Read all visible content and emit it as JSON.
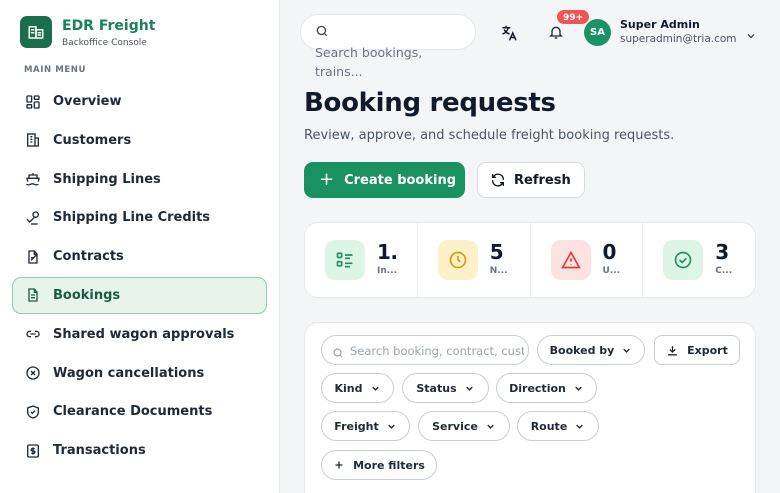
{
  "brand": {
    "name": "EDR Freight",
    "subtitle": "Backoffice Console",
    "icon": "building-icon"
  },
  "sidebar": {
    "section_label": "MAIN MENU",
    "items": [
      {
        "label": "Overview",
        "icon": "grid-icon"
      },
      {
        "label": "Customers",
        "icon": "building-icon"
      },
      {
        "label": "Shipping Lines",
        "icon": "ship-icon"
      },
      {
        "label": "Shipping Line Credits",
        "icon": "credit-icon"
      },
      {
        "label": "Contracts",
        "icon": "contract-icon"
      },
      {
        "label": "Bookings",
        "icon": "document-icon",
        "active": true
      },
      {
        "label": "Shared wagon approvals",
        "icon": "link-icon"
      },
      {
        "label": "Wagon cancellations",
        "icon": "x-circle-icon"
      },
      {
        "label": "Clearance Documents",
        "icon": "shield-check-icon"
      },
      {
        "label": "Transactions",
        "icon": "dollar-icon"
      }
    ]
  },
  "topbar": {
    "search_placeholder": "Search bookings, trains...",
    "notifications_badge": "99+",
    "user": {
      "initials": "SA",
      "name": "Super Admin",
      "email": "superadmin@tria.com"
    }
  },
  "header": {
    "title": "Booking requests",
    "subtitle": "Review, approve, and schedule freight booking requests.",
    "create_label": "Create booking",
    "refresh_label": "Refresh"
  },
  "stats": [
    {
      "value": "1...",
      "label": "In...",
      "icon": "list-icon",
      "bg": "#ddf5e7",
      "color": "#1f8f5f"
    },
    {
      "value": "5",
      "label": "N...",
      "icon": "clock-icon",
      "bg": "#fdf1c9",
      "color": "#d99a06"
    },
    {
      "value": "0",
      "label": "U...",
      "icon": "alert-icon",
      "bg": "#fde2e2",
      "color": "#e03c3c"
    },
    {
      "value": "3",
      "label": "C...",
      "icon": "check-circle-icon",
      "bg": "#ddf5e7",
      "color": "#1f8f5f"
    }
  ],
  "filters": {
    "search_placeholder": "Search booking, contract, customer",
    "booked_by": "Booked by",
    "export": "Export",
    "kind": "Kind",
    "status": "Status",
    "direction": "Direction",
    "freight": "Freight",
    "service": "Service",
    "route": "Route",
    "more": "More filters"
  },
  "colors": {
    "accent": "#199160",
    "brand": "#16835b",
    "active_bg": "#e6f4ec"
  }
}
